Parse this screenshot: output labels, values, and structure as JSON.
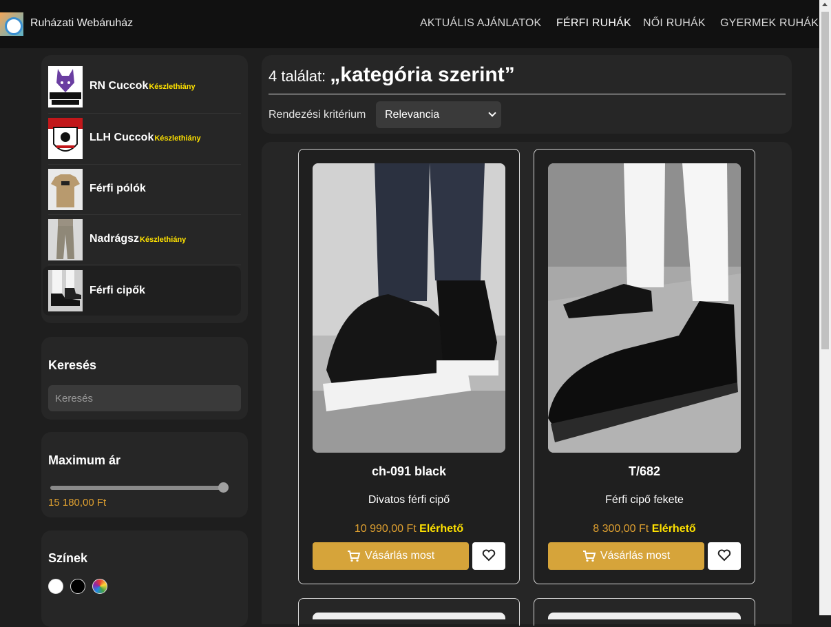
{
  "header": {
    "brand": "Ruházati Webáruház",
    "nav": [
      "AKTUÁLIS AJÁNLATOK",
      "FÉRFI RUHÁK",
      "NŐI RUHÁK",
      "GYERMEK RUHÁK"
    ],
    "active_nav": "FÉRFI RUHÁK"
  },
  "sidebar": {
    "categories": [
      {
        "label": "RN Cuccok",
        "badge": "Készlethiány"
      },
      {
        "label": "LLH Cuccok",
        "badge": "Készlethiány"
      },
      {
        "label": "Férfi pólók",
        "badge": ""
      },
      {
        "label": "Nadrágsz",
        "badge": "Készlethiány"
      },
      {
        "label": "Férfi cipők",
        "badge": ""
      }
    ],
    "selected_category": "Férfi cipők",
    "search": {
      "title": "Keresés",
      "placeholder": "Keresés",
      "value": ""
    },
    "max_price": {
      "title": "Maximum ár",
      "value_text": "15 180,00 Ft",
      "slider_fraction": 1.0
    },
    "colors": {
      "title": "Színek",
      "swatches": [
        "#ffffff",
        "#000000",
        "rainbow"
      ]
    }
  },
  "results": {
    "count": "4 találat:",
    "title": "„kategória szerint”",
    "sort_label": "Rendezési kritérium",
    "sort_value": "Relevancia"
  },
  "products": [
    {
      "name": "ch-091 black",
      "description": "Divatos férfi cipő",
      "price": "10 990,00 Ft",
      "availability": "Elérhető",
      "buy_label": "Vásárlás most"
    },
    {
      "name": "T/682",
      "description": "Férfi cipő fekete",
      "price": "8 300,00 Ft",
      "availability": "Elérhető",
      "buy_label": "Vásárlás most"
    }
  ],
  "colors": {
    "accent": "#d6a43a",
    "price": "#e0a130",
    "stock_badge": "#ffe200",
    "background": "#1e1e1e",
    "panel": "#262626"
  }
}
